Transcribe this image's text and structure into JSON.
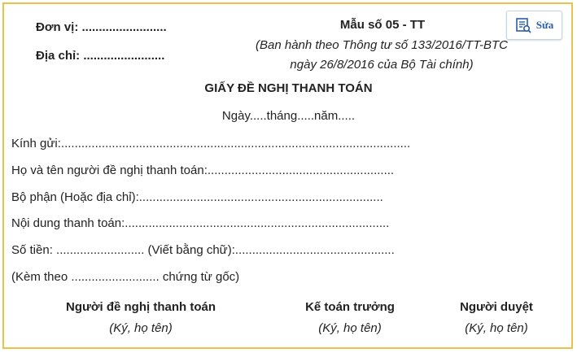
{
  "header": {
    "unit_line": "Đơn vị: .........................",
    "address_line": "Địa chỉ: ........................",
    "form_number": "Mẫu số 05 - TT",
    "issued_line1": "(Ban hành theo Thông tư số 133/2016/TT-BTC",
    "issued_line2": "ngày 26/8/2016 của Bộ Tài chính)"
  },
  "edit_button": {
    "label": "Sửa",
    "icon": "edit-document-icon",
    "color": "#2a5db0"
  },
  "title": "GIẤY ĐỀ NGHỊ THANH TOÁN",
  "date_line": "Ngày.....tháng.....năm.....",
  "fields": [
    "Kính gửi:.......................................................................................................",
    "Họ và tên người đề nghị thanh toán:.......................................................",
    "Bộ phận (Hoặc địa chỉ):........................................................................",
    "Nội dung thanh toán:..............................................................................",
    "Số tiền: .......................... (Viết bằng chữ):...............................................",
    "(Kèm theo .......................... chứng từ gốc)"
  ],
  "signatures": [
    {
      "role": "Người đề nghị thanh toán",
      "note": "(Ký, họ tên)"
    },
    {
      "role": "Kế toán trưởng",
      "note": "(Ký, họ tên)"
    },
    {
      "role": "Người duyệt",
      "note": "(Ký, họ tên)"
    }
  ],
  "colors": {
    "border": "#e8c24a",
    "text": "#222222"
  }
}
